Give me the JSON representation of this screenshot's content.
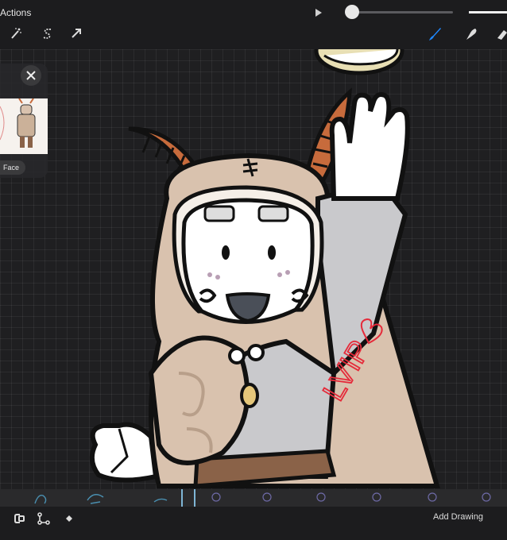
{
  "topbar": {
    "actions_label": "Actions",
    "tools": [
      {
        "name": "adjustments",
        "icon": "magic-wand-icon"
      },
      {
        "name": "selection",
        "icon": "selection-s-icon"
      },
      {
        "name": "transform",
        "icon": "arrow-cursor-icon"
      },
      {
        "name": "brush",
        "icon": "brush-icon",
        "active": true,
        "color": "#1e88ff"
      },
      {
        "name": "smudge",
        "icon": "smudge-icon"
      },
      {
        "name": "eraser",
        "icon": "eraser-icon"
      }
    ],
    "playback_slider_value": 0.06
  },
  "reference": {
    "close_icon": "close-icon",
    "tag_label": "Face"
  },
  "artwork": {
    "handwriting": "LVIP"
  },
  "bottombar": {
    "add_drawing_label": "Add Drawing",
    "tools": [
      "onion-skin-icon",
      "timeline-settings-icon",
      "keyframe-icon"
    ]
  },
  "colors": {
    "background": "#1c1c1e",
    "accent": "#1e88ff",
    "skin": "#d9c2ae",
    "tunic": "#c9c9cc"
  }
}
